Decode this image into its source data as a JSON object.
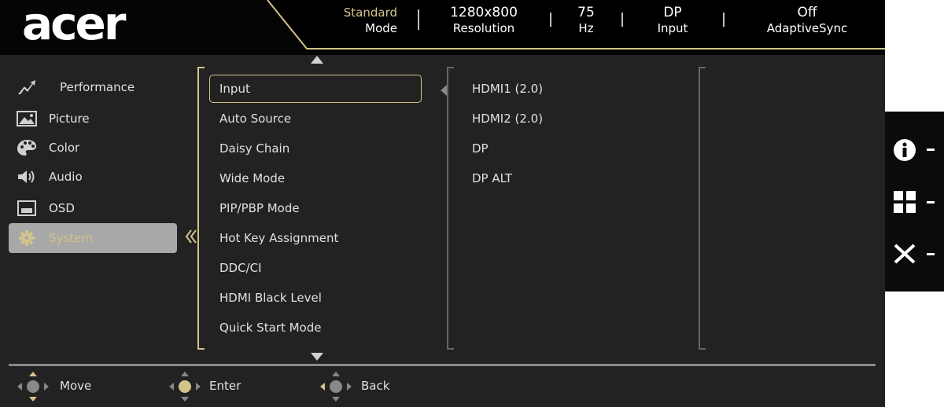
{
  "brand": "acer",
  "status_bar": [
    {
      "value": "Standard",
      "label": "Mode"
    },
    {
      "value": "1280x800",
      "label": "Resolution"
    },
    {
      "value": "75",
      "label": "Hz"
    },
    {
      "value": "DP",
      "label": "Input"
    },
    {
      "value": "Off",
      "label": "AdaptiveSync"
    }
  ],
  "main_menu": [
    {
      "label": "Performance",
      "icon": "performance-icon"
    },
    {
      "label": "Picture",
      "icon": "picture-icon"
    },
    {
      "label": "Color",
      "icon": "palette-icon"
    },
    {
      "label": "Audio",
      "icon": "speaker-icon"
    },
    {
      "label": "OSD",
      "icon": "osd-icon"
    },
    {
      "label": "System",
      "icon": "gear-icon",
      "active": true
    }
  ],
  "submenu": [
    "Input",
    "Auto Source",
    "Daisy Chain",
    "Wide Mode",
    "PIP/PBP Mode",
    "Hot Key Assignment",
    "DDC/CI",
    "HDMI Black Level",
    "Quick Start Mode"
  ],
  "submenu_selected": "Input",
  "values": [
    "HDMI1 (2.0)",
    "HDMI2 (2.0)",
    "DP",
    "DP ALT"
  ],
  "bottom_hints": [
    {
      "label": "Move",
      "icon": "joystick-move-icon"
    },
    {
      "label": "Enter",
      "icon": "joystick-enter-icon"
    },
    {
      "label": "Back",
      "icon": "joystick-back-icon"
    }
  ],
  "side_keys": [
    "info-icon",
    "menu-grid-icon",
    "close-icon"
  ],
  "colors": {
    "accent": "#d4c48a",
    "panel": "#222222",
    "active": "#a8a8a8"
  }
}
